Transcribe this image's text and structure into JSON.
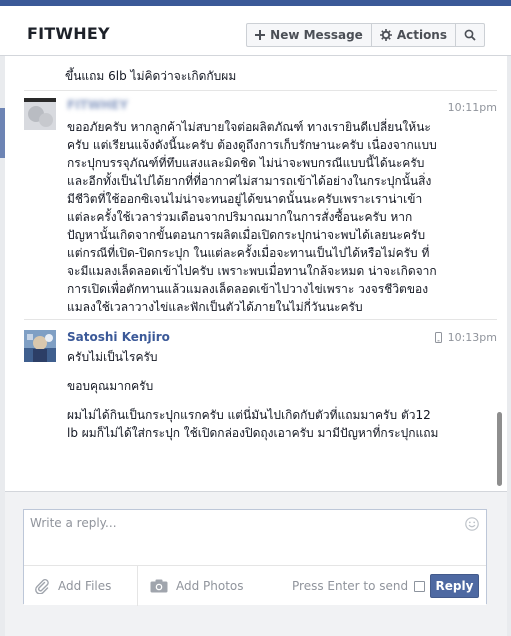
{
  "header": {
    "title": "FITWHEY",
    "new_message_label": "New Message",
    "actions_label": "Actions",
    "icons": {
      "new_message": "plus-icon",
      "actions": "gear-icon",
      "search": "search-icon"
    }
  },
  "thread": {
    "previous_tail": "ขึ้นแถม 6lb ไม่คิดว่าจะเกิดกับผม",
    "messages": [
      {
        "sender": "FITWHEY",
        "time": "10:11pm",
        "avatar": "blurred-avatar",
        "paragraphs": [
          "ขออภัยครับ หากลูกค้าไม่สบายใจต่อผลิตภัณฑ์ ทางเรายินดีเปลี่ยนให้นะครับ แต่เรียนแจ้งดังนี้นะครับ ต้องดูถึงการเก็บรักษานะครับ เนื่องจากแบบกระปุกบรรจุภัณฑ์ที่ทึบแสงและมิดชิด ไม่น่าจะพบกรณีแบบนี้ได้นะครับ และอีกทั้งเป็นไปได้ยากที่ที่อากาศไม่สามารถเข้าได้อย่างในกระปุกนั้นสิ่งมีชีวิตที่ใช้ออกซิเจนไม่น่าจะทนอยู่ได้ขนาดนั้นนะครับเพราะเราน่าเข้าแต่ละครั้งใช้เวลาร่วมเดือนจากปริมาณมากในการสั่งซื้อนะครับ หากปัญหานั้นเกิดจากขั้นตอนการผลิตเมื่อเปิดกระปุกน่าจะพบได้เลยนะครับ แต่กรณีที่เปิด-ปิดกระปุก ในแต่ละครั้งเมื่อจะทานเป็นไปได้หรือไม่ครับ ที่จะมีแมลงเล็ดลอดเข้าไปครับ เพราะพบเมื่อทานใกล้จะหมด น่าจะเกิดจากการเปิดเพื่อตักทานแล้วแมลงเล็ดลอดเข้าไปวางไข่เพราะ วงจรชีวิตของแมลงใช้เวลาวางไข่และฟักเป็นตัวได้ภายในไม่กี่วันนะครับ"
        ]
      },
      {
        "sender": "Satoshi Kenjiro",
        "time": "10:13pm",
        "avatar": "profile-avatar",
        "device_icon": "mobile-phone-icon",
        "paragraphs": [
          "ครับไม่เป็นไรครับ",
          "ขอบคุณมากครับ",
          "ผมไม่ได้กินเป็นกระปุกแรกครับ แต่นี่มันไปเกิดกับตัวที่แถมมาครับ ตัว12 lb ผมก็ไม่ได้ใส่กระปุก ใช้เปิดกล่องปิดถุงเอาครับ มามีปัญหาที่กระปุกแถม"
        ]
      }
    ]
  },
  "composer": {
    "placeholder": "Write a reply...",
    "add_files_label": "Add Files",
    "add_photos_label": "Add Photos",
    "press_enter_label": "Press Enter to send",
    "press_enter_checked": false,
    "reply_label": "Reply",
    "icons": {
      "emoji": "smiley-icon",
      "files": "paperclip-icon",
      "photos": "camera-icon"
    }
  },
  "colors": {
    "brand": "#3b5998",
    "reply_button": "#4e69a2",
    "sender_link": "#3b5998",
    "muted_text": "#90949c"
  }
}
